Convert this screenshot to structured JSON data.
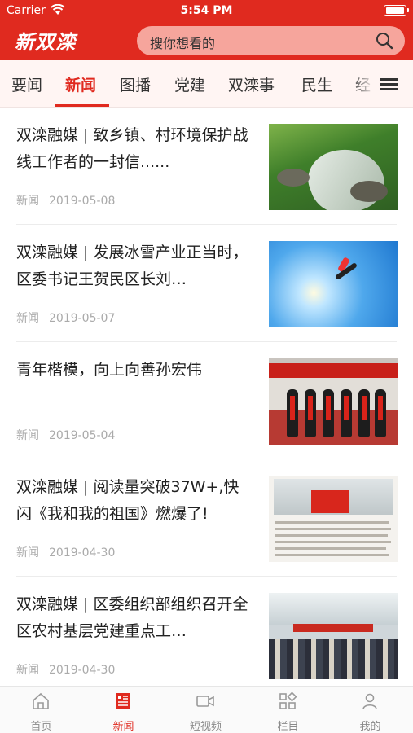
{
  "status_bar": {
    "carrier": "Carrier",
    "time": "5:54 PM"
  },
  "header": {
    "logo": "新双滦",
    "search_placeholder": "搜你想看的"
  },
  "tabs": [
    {
      "label": "要闻",
      "active": false
    },
    {
      "label": "新闻",
      "active": true
    },
    {
      "label": "图播",
      "active": false
    },
    {
      "label": "党建",
      "active": false
    },
    {
      "label": "双滦事",
      "active": false
    },
    {
      "label": "民生",
      "active": false
    },
    {
      "label": "经",
      "active": false
    }
  ],
  "articles": [
    {
      "title": "双滦融媒 | 致乡镇、村环境保护战线工作者的一封信......",
      "category": "新闻",
      "date": "2019-05-08",
      "thumbnail": "stream-forest-photo"
    },
    {
      "title": "双滦融媒 | 发展冰雪产业正当时，区委书记王贺民区长刘…",
      "category": "新闻",
      "date": "2019-05-07",
      "thumbnail": "ski-jump-photo"
    },
    {
      "title": "青年楷模，向上向善孙宏伟",
      "category": "新闻",
      "date": "2019-05-04",
      "thumbnail": "award-ceremony-photo"
    },
    {
      "title": "双滦融媒 | 阅读量突破37W+,快闪《我和我的祖国》燃爆了!",
      "category": "新闻",
      "date": "2019-04-30",
      "thumbnail": "flag-flashmob-photo"
    },
    {
      "title": "双滦融媒 | 区委组织部组织召开全区农村基层党建重点工…",
      "category": "新闻",
      "date": "2019-04-30",
      "thumbnail": "conference-hall-photo"
    }
  ],
  "bottom_tabs": [
    {
      "label": "首页",
      "icon": "home-icon",
      "active": false
    },
    {
      "label": "新闻",
      "icon": "news-icon",
      "active": true
    },
    {
      "label": "短视频",
      "icon": "video-icon",
      "active": false
    },
    {
      "label": "栏目",
      "icon": "grid-icon",
      "active": false
    },
    {
      "label": "我的",
      "icon": "profile-icon",
      "active": false
    }
  ],
  "colors": {
    "brand_red": "#e02a1f",
    "search_bg": "#f6a59c",
    "tab_bg": "#fff5f3"
  }
}
